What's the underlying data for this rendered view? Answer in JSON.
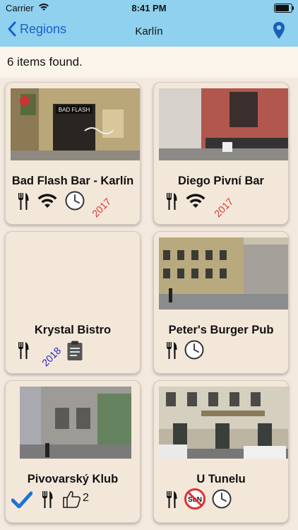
{
  "status_bar": {
    "carrier": "Carrier",
    "time": "8:41 PM"
  },
  "nav": {
    "back_label": "Regions",
    "title": "Karlín"
  },
  "results": {
    "count_text": "6 items found."
  },
  "cards": [
    {
      "name": "Bad Flash Bar - Karlín",
      "icons": [
        "fork-knife-icon",
        "wifi-icon",
        "clock-icon"
      ],
      "year": "2017",
      "year_color": "#d33b35",
      "photo": "building-photo"
    },
    {
      "name": "Diego Pivní Bar",
      "icons": [
        "fork-knife-icon",
        "wifi-icon"
      ],
      "year": "2017",
      "year_color": "#d33b35",
      "photo": "building-photo"
    },
    {
      "name": "Krystal Bistro",
      "icons": [
        "fork-knife-icon",
        "clipboard-icon"
      ],
      "year": "2018",
      "year_color": "#2424c8",
      "photo": ""
    },
    {
      "name": "Peter's Burger Pub",
      "icons": [
        "fork-knife-icon",
        "clock-icon"
      ],
      "photo": "building-photo"
    },
    {
      "name": "Pivovarský Klub",
      "icons": [
        "checkmark-icon",
        "fork-knife-icon",
        "thumbs-up-icon"
      ],
      "likes": "2",
      "photo": "building-photo"
    },
    {
      "name": "U Tunelu",
      "icons": [
        "fork-knife-icon",
        "no-sunday-icon",
        "clock-icon"
      ],
      "no_sunday_text": "SuN",
      "photo": "building-photo"
    }
  ],
  "colors": {
    "nav_bg": "#8fd1ee",
    "accent": "#1b62c6",
    "card_bg": "#f3e7da",
    "page_bg": "#f3e9df"
  }
}
